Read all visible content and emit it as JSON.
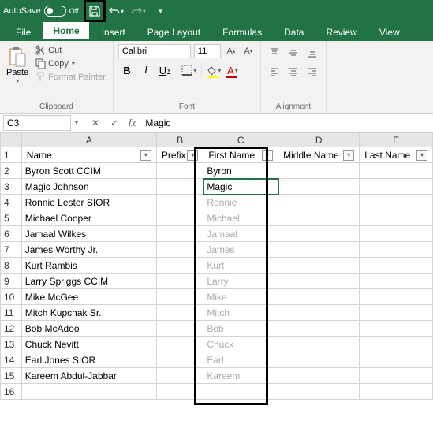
{
  "titlebar": {
    "autosave": "AutoSave",
    "off": "Off"
  },
  "tabs": {
    "file": "File",
    "home": "Home",
    "insert": "Insert",
    "page_layout": "Page Layout",
    "formulas": "Formulas",
    "data": "Data",
    "review": "Review",
    "view": "View"
  },
  "ribbon": {
    "paste": "Paste",
    "cut": "Cut",
    "copy": "Copy",
    "format_painter": "Format Painter",
    "clipboard": "Clipboard",
    "font_name": "Calibri",
    "font_size": "11",
    "font": "Font",
    "alignment": "Alignment"
  },
  "formula_bar": {
    "cell_ref": "C3",
    "value": "Magic"
  },
  "columns": [
    "A",
    "B",
    "C",
    "D",
    "E"
  ],
  "headers": {
    "name": "Name",
    "prefix": "Prefix",
    "first_name": "First Name",
    "middle_name": "Middle Name",
    "last_name": "Last Name"
  },
  "rows": [
    {
      "n": 1
    },
    {
      "n": 2,
      "name": "Byron Scott CCIM",
      "first": "Byron",
      "cls": ""
    },
    {
      "n": 3,
      "name": "Magic Johnson",
      "first": "Magic",
      "cls": "active-cell"
    },
    {
      "n": 4,
      "name": "Ronnie Lester SIOR",
      "first": "Ronnie",
      "cls": "suggestion"
    },
    {
      "n": 5,
      "name": "Michael Cooper",
      "first": "Michael",
      "cls": "suggestion"
    },
    {
      "n": 6,
      "name": "Jamaal Wilkes",
      "first": "Jamaal",
      "cls": "suggestion"
    },
    {
      "n": 7,
      "name": "James Worthy Jr.",
      "first": "James",
      "cls": "suggestion"
    },
    {
      "n": 8,
      "name": "Kurt Rambis",
      "first": "Kurt",
      "cls": "suggestion"
    },
    {
      "n": 9,
      "name": "Larry Spriggs CCIM",
      "first": "Larry",
      "cls": "suggestion"
    },
    {
      "n": 10,
      "name": "Mike McGee",
      "first": "Mike",
      "cls": "suggestion"
    },
    {
      "n": 11,
      "name": "Mitch Kupchak Sr.",
      "first": "Mitch",
      "cls": "suggestion"
    },
    {
      "n": 12,
      "name": "Bob McAdoo",
      "first": "Bob",
      "cls": "suggestion"
    },
    {
      "n": 13,
      "name": "Chuck Nevitt",
      "first": "Chuck",
      "cls": "suggestion"
    },
    {
      "n": 14,
      "name": "Earl Jones SIOR",
      "first": "Earl",
      "cls": "suggestion"
    },
    {
      "n": 15,
      "name": "Kareem Abdul-Jabbar",
      "first": "Kareem",
      "cls": "suggestion"
    },
    {
      "n": 16
    }
  ]
}
